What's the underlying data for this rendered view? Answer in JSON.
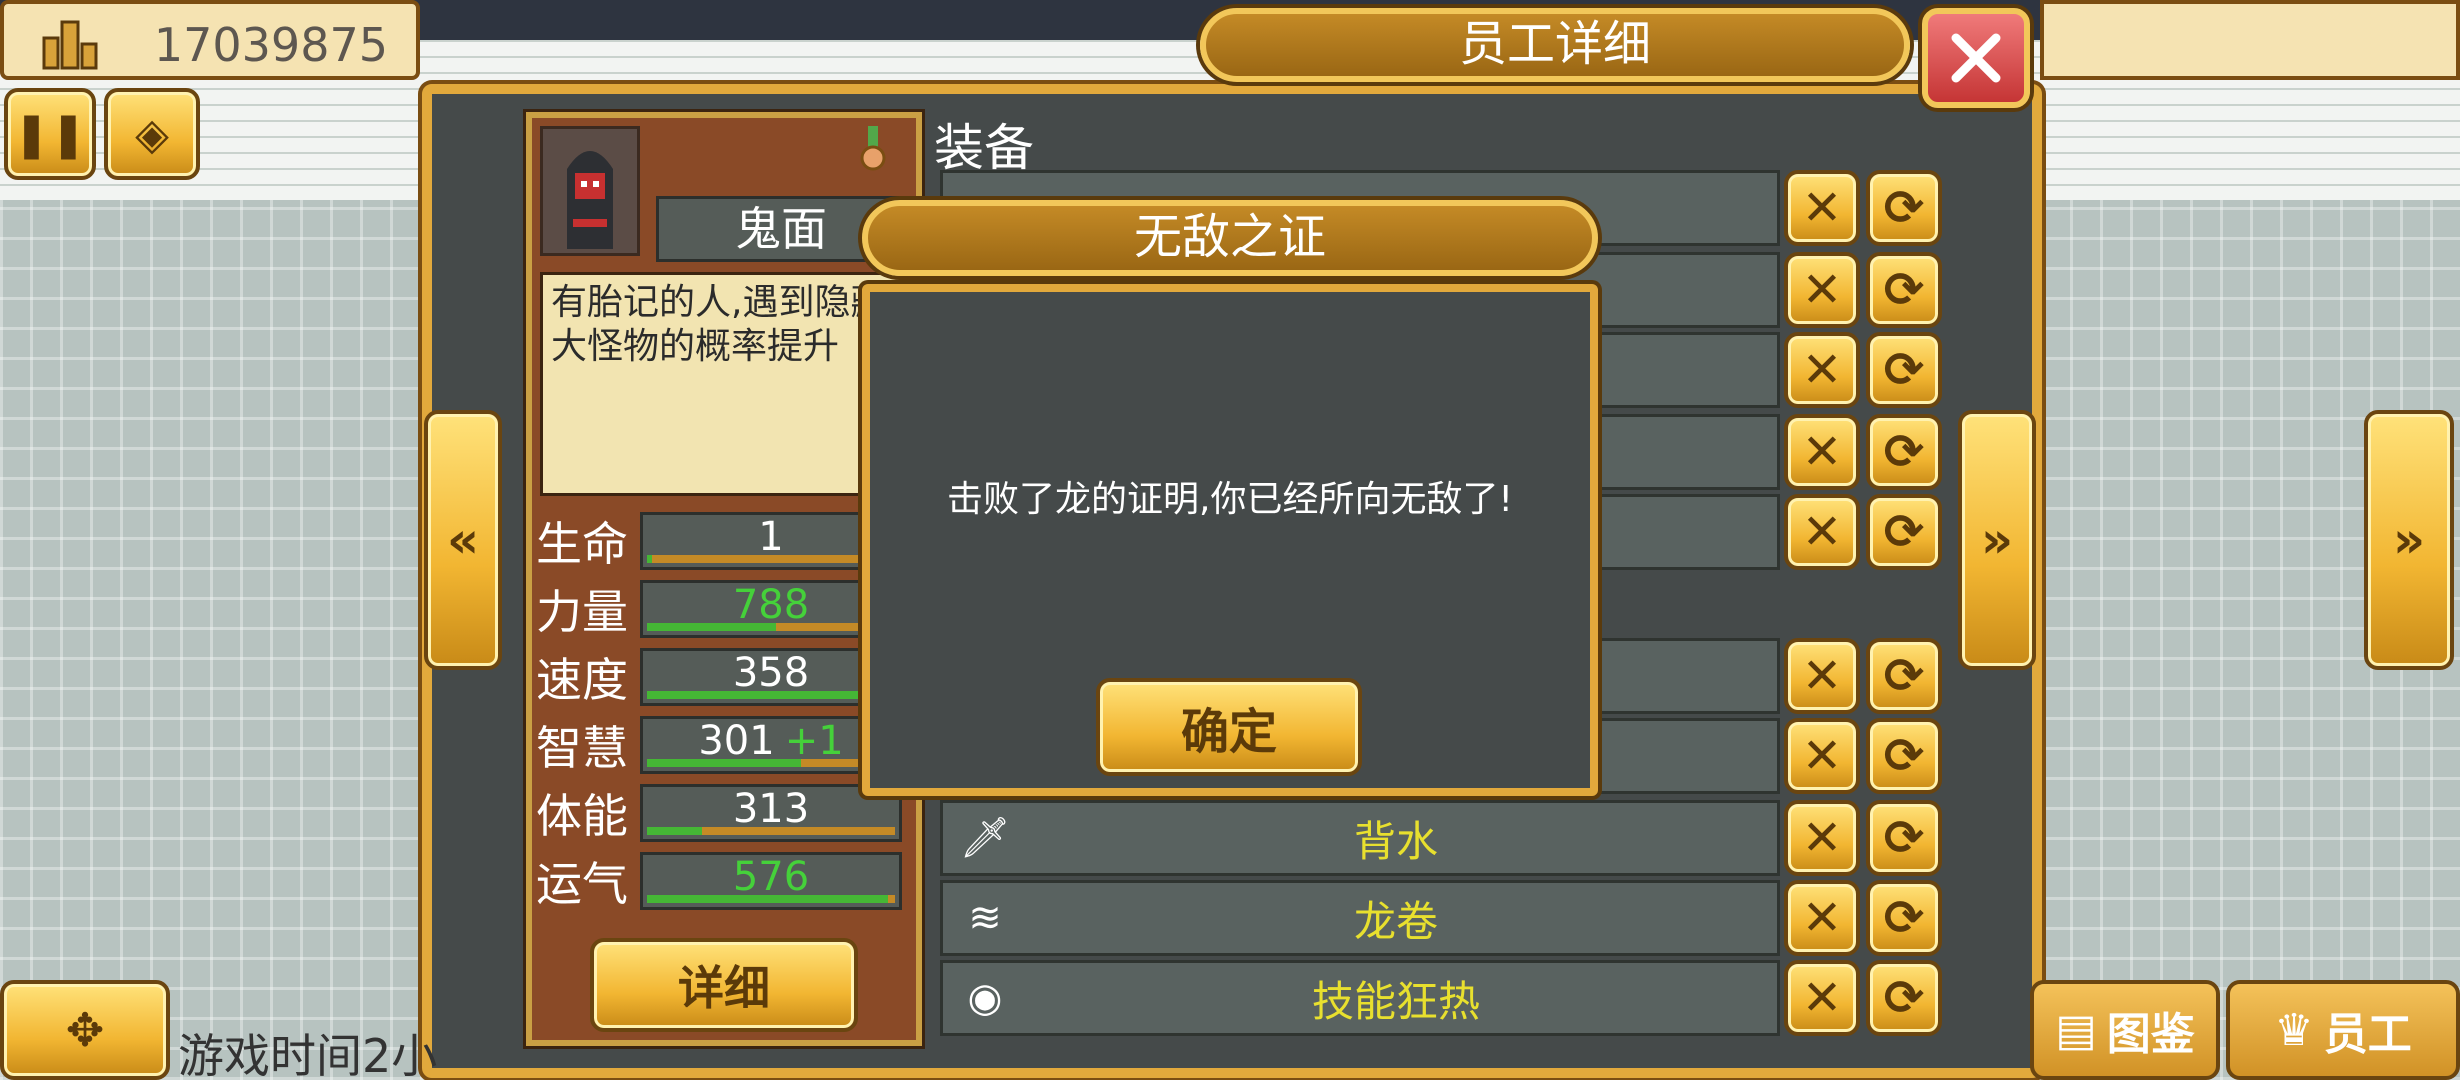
{
  "hud": {
    "money": "17039875",
    "icons": {
      "money": "building-icon",
      "pause": "pause-icon",
      "speed": "coins-icon"
    }
  },
  "window": {
    "title": "员工详细",
    "equip_heading": "装备"
  },
  "employee": {
    "name": "鬼面",
    "description": "有胎记的人,遇到隐藏大怪物的概率提升",
    "detail_button": "详细",
    "stats": [
      {
        "label": "生命",
        "value": "1",
        "color": "#ffffff",
        "fill": 0.02
      },
      {
        "label": "力量",
        "value": "788",
        "color": "#45d13a",
        "fill": 0.52
      },
      {
        "label": "速度",
        "value": "358",
        "color": "#ffffff",
        "fill": 0.95
      },
      {
        "label": "智慧",
        "value": "301",
        "bonus": "+1",
        "color": "#ffffff",
        "fill": 0.62
      },
      {
        "label": "体能",
        "value": "313",
        "color": "#ffffff",
        "fill": 0.22
      },
      {
        "label": "运气",
        "value": "576",
        "color": "#45d13a",
        "fill": 0.97
      }
    ]
  },
  "skills": [
    {
      "name": "背水",
      "icon": "sword-icon"
    },
    {
      "name": "龙卷",
      "icon": "tornado-icon"
    },
    {
      "name": "技能狂热",
      "icon": "orb-icon"
    }
  ],
  "dialog": {
    "title": "无敌之证",
    "message": "击败了龙的证明,你已经所向无敌了!",
    "ok": "确定"
  },
  "footer": {
    "game_time": "游戏时间2小",
    "encyclopedia": "图鉴",
    "staff": "员工"
  }
}
